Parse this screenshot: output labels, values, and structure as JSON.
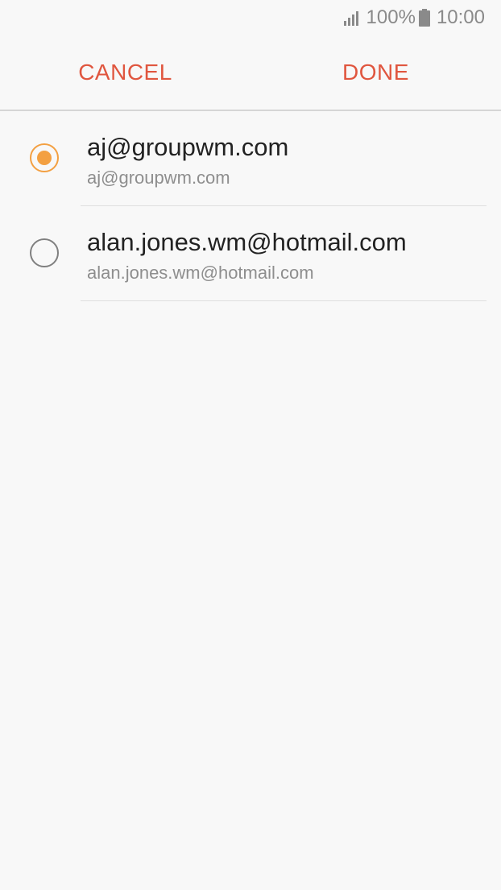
{
  "status_bar": {
    "battery": "100%",
    "time": "10:00",
    "icons": [
      "signal-icon",
      "battery-icon"
    ]
  },
  "action_bar": {
    "cancel_label": "CANCEL",
    "done_label": "DONE"
  },
  "accounts": [
    {
      "title": "aj@groupwm.com",
      "subtitle": "aj@groupwm.com",
      "selected": true
    },
    {
      "title": "alan.jones.wm@hotmail.com",
      "subtitle": "alan.jones.wm@hotmail.com",
      "selected": false
    }
  ],
  "colors": {
    "accent": "#e0563f",
    "radio_selected": "#f3a042",
    "radio_unselected": "#808080",
    "background": "#f8f8f8"
  }
}
